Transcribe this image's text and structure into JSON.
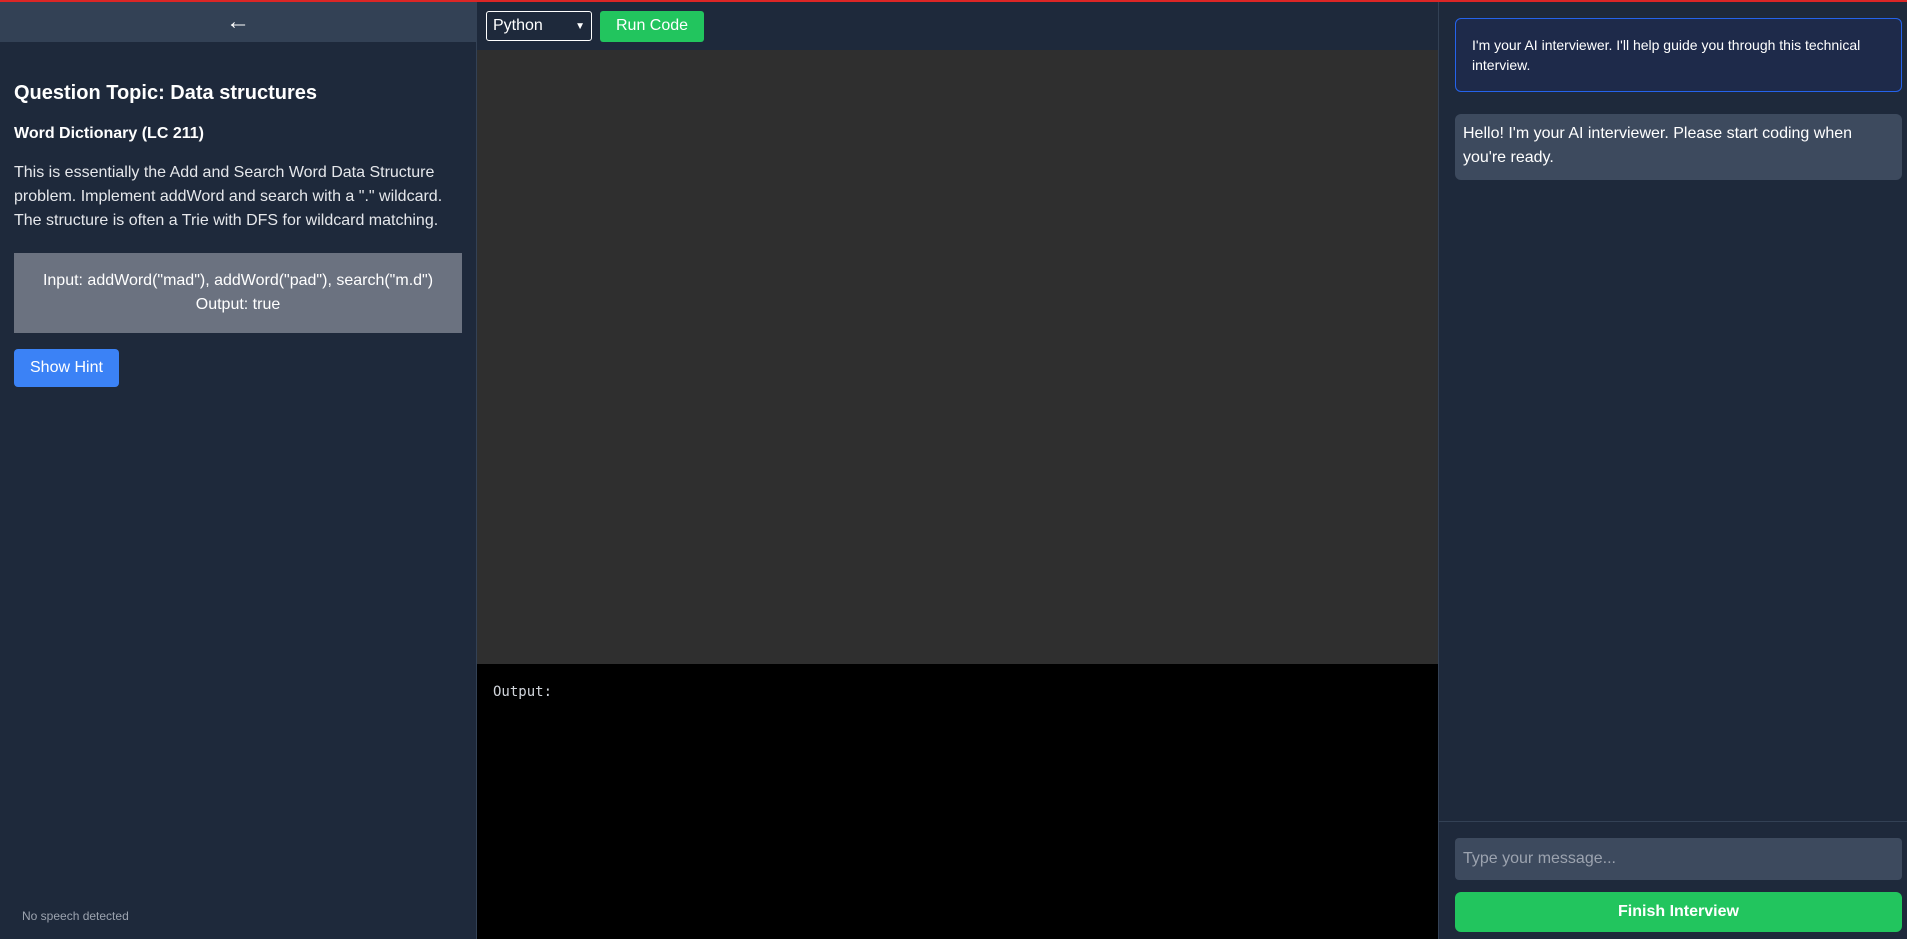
{
  "left": {
    "back_icon": "←",
    "topic_title": "Question Topic: Data structures",
    "problem_title": "Word Dictionary (LC 211)",
    "description": "This is essentially the Add and Search Word Data Structure problem. Implement addWord and search with a \".\" wildcard. The structure is often a Trie with DFS for wildcard matching.",
    "example_input": "Input: addWord(\"mad\"), addWord(\"pad\"), search(\"m.d\")",
    "example_output": "Output: true",
    "hint_button": "Show Hint",
    "speech_status": "No speech detected"
  },
  "toolbar": {
    "language": "Python",
    "run_button": "Run Code"
  },
  "output": {
    "label": "Output:"
  },
  "chat": {
    "intro_message": "I'm your AI interviewer. I'll help guide you through this technical interview.",
    "messages": [
      {
        "text": "Hello! I'm your AI interviewer. Please start coding when you're ready."
      }
    ],
    "input_placeholder": "Type your message...",
    "finish_button": "Finish Interview"
  },
  "colors": {
    "background": "#1e293b",
    "accent_green": "#22c55e",
    "accent_blue": "#3b82f6",
    "top_border": "#dc2626"
  }
}
